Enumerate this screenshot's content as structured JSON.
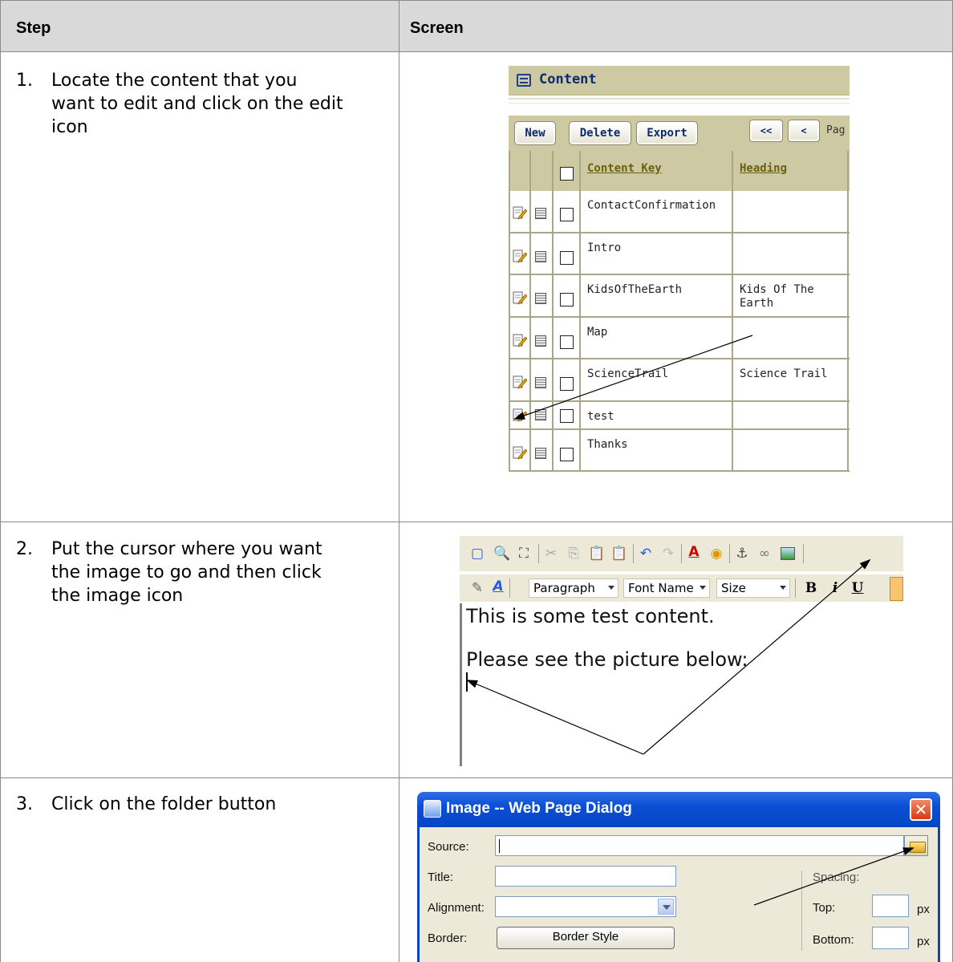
{
  "table": {
    "col_step": "Step",
    "col_screen": "Screen"
  },
  "steps": [
    {
      "number": "1.",
      "lines": [
        "Locate the content that you",
        "want to edit and click on the edit",
        "icon"
      ]
    },
    {
      "number": "2.",
      "lines": [
        "Put the cursor where you want",
        "the image to go and then click",
        "the image icon"
      ]
    },
    {
      "number": "3.",
      "lines": [
        "Click on the folder button"
      ]
    }
  ],
  "content_screen": {
    "title": "Content",
    "buttons": {
      "new": "New",
      "delete": "Delete",
      "export": "Export"
    },
    "nav": {
      "first": "<<",
      "prev": "<",
      "page_fragment": "Pag"
    },
    "columns": {
      "content_key": "Content Key",
      "heading": "Heading"
    },
    "rows": [
      {
        "key": "ContactConfirmation",
        "heading": ""
      },
      {
        "key": "Intro",
        "heading": ""
      },
      {
        "key": "KidsOfTheEarth",
        "heading": "Kids Of The Earth"
      },
      {
        "key": "Map",
        "heading": ""
      },
      {
        "key": "ScienceTrail",
        "heading": "Science Trail"
      },
      {
        "key": "test",
        "heading": ""
      },
      {
        "key": "Thanks",
        "heading": ""
      }
    ],
    "heading_lines": {
      "kids1": "Kids Of The",
      "kids2": "Earth"
    }
  },
  "editor_screen": {
    "dropdowns": {
      "format": "Paragraph",
      "font": "Font Name",
      "size": "Size"
    },
    "content_lines": [
      "This is some test content.",
      "Please see the picture below:"
    ],
    "bold": "B",
    "italic": "i",
    "underline": "U"
  },
  "image_dialog": {
    "title": "Image -- Web Page Dialog",
    "close": "✕",
    "labels": {
      "source": "Source:",
      "title": "Title:",
      "alignment": "Alignment:",
      "border": "Border:",
      "spacing": "Spacing:",
      "top": "Top:",
      "bottom": "Bottom:",
      "px": "px"
    },
    "border_style_button": "Border Style"
  },
  "colors": {
    "header_bg": "#d9d9d9",
    "panel_tan": "#ccc9a3",
    "xp_blue": "#0a4fd6",
    "xp_face": "#ece9d8"
  }
}
